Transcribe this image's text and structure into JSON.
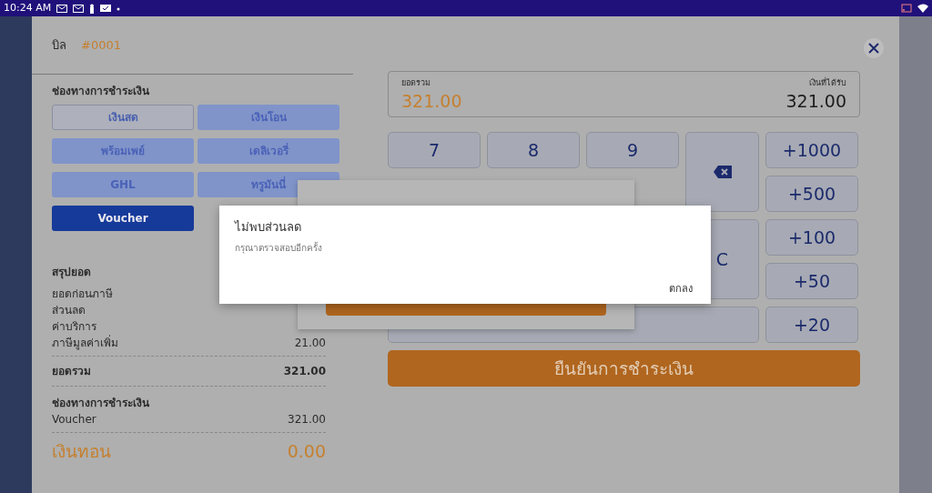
{
  "status_bar": {
    "time": "10:24 AM"
  },
  "payment_modal": {
    "bill_label": "บิล",
    "bill_number": "#0001",
    "methods_title": "ช่องทางการชำระเงิน",
    "methods": [
      {
        "label": "เงินสด",
        "kind": "outline",
        "selected": false
      },
      {
        "label": "เงินโอน",
        "kind": "soft",
        "selected": false
      },
      {
        "label": "พร้อมเพย์",
        "kind": "soft",
        "selected": false
      },
      {
        "label": "เดลิเวอรี่",
        "kind": "soft",
        "selected": false
      },
      {
        "label": "GHL",
        "kind": "soft",
        "selected": false
      },
      {
        "label": "ทรูมันนี่",
        "kind": "soft",
        "selected": false
      },
      {
        "label": "Voucher",
        "selected": true
      }
    ],
    "summary": {
      "title": "สรุปยอด",
      "rows": [
        {
          "label": "ยอดก่อนภาษี"
        },
        {
          "label": "ส่วนลด"
        },
        {
          "label": "ค่าบริการ"
        },
        {
          "label": "ภาษีมูลค่าเพิ่ม",
          "value": "21.00"
        }
      ],
      "total_label": "ยอดรวม",
      "total": "321.00",
      "payments_title": "ช่องทางการชำระเงิน",
      "payments": [
        {
          "label": "Voucher",
          "value": "321.00"
        }
      ],
      "change_label": "เงินทอน",
      "change": "0.00"
    },
    "amount": {
      "total_label": "ยอดรวม",
      "total": "321.00",
      "received_label": "เงินที่ได้รับ",
      "received": "321.00"
    },
    "keypad": [
      {
        "kind": "digit",
        "label": "7"
      },
      {
        "kind": "digit",
        "label": "8"
      },
      {
        "kind": "digit",
        "label": "9"
      },
      {
        "kind": "backspace"
      },
      {
        "kind": "quick",
        "label": "+1000"
      },
      {
        "kind": "quick",
        "label": "+500"
      },
      {
        "kind": "clear",
        "label": "C"
      },
      {
        "kind": "quick",
        "label": "+100"
      },
      {
        "kind": "quick",
        "label": "+50"
      },
      {
        "kind": "exact"
      },
      {
        "kind": "quick",
        "label": "+20"
      }
    ],
    "confirm_button": "ยืนยันการชำระเงิน"
  },
  "alert": {
    "title": "ไม่พบส่วนลด",
    "message": "กรุณาตรวจสอบอีกครั้ง",
    "button": "ตกลง"
  }
}
